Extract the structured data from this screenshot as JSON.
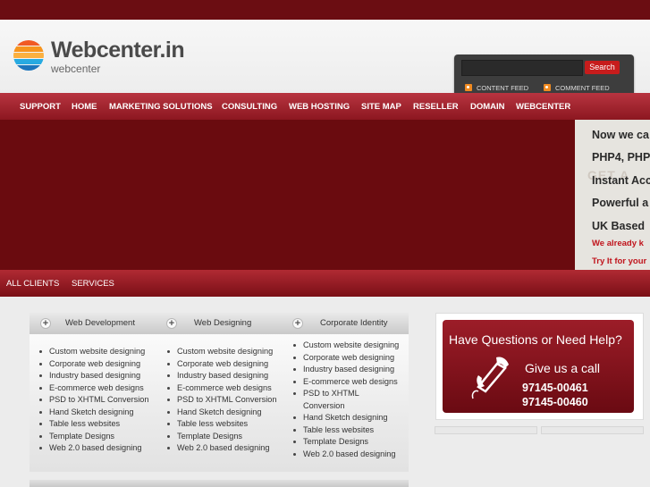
{
  "brand": {
    "title": "Webcenter.in",
    "subtitle": "webcenter"
  },
  "search": {
    "button_label": "Search"
  },
  "feeds": {
    "content": "CONTENT FEED",
    "comment": "COMMENT FEED"
  },
  "nav": [
    "SUPPORT",
    "HOME",
    "MARKETING SOLUTIONS",
    "CONSULTING",
    "WEB HOSTING",
    "SITE MAP",
    "RESELLER",
    "DOMAIN",
    "WEBCENTER"
  ],
  "banner_panel": {
    "lines": [
      "Now we ca",
      "PHP4, PHP",
      "Instant Acc",
      "Powerful a",
      "UK Based"
    ],
    "red_lines": [
      "We already k",
      "Try It for your"
    ],
    "ghost_text": "GET A"
  },
  "subnav": [
    "ALL CLIENTS",
    "SERVICES"
  ],
  "columns": [
    {
      "title": "Web Development",
      "items": [
        "Custom website designing",
        "Corporate web designing",
        "Industry based designing",
        "E-commerce web designs",
        "PSD to XHTML Conversion",
        "Hand Sketch designing",
        "Table less websites",
        "Template Designs",
        "Web 2.0 based designing"
      ]
    },
    {
      "title": "Web Designing",
      "items": [
        "Custom website designing",
        "Corporate web designing",
        "Industry based designing",
        "E-commerce web designs",
        "PSD to XHTML Conversion",
        "Hand Sketch designing",
        "Table less websites",
        "Template Designs",
        "Web 2.0 based designing"
      ]
    },
    {
      "title": "Corporate Identity",
      "items": [
        "Custom website designing",
        "Corporate web designing",
        "Industry based designing",
        "E-commerce web designs",
        "PSD to XHTML",
        "Conversion",
        "Hand Sketch designing",
        "Table less websites",
        "Template Designs",
        "Web 2.0 based designing"
      ]
    }
  ],
  "help": {
    "title": "Have Questions or Need Help?",
    "call": "Give us a call",
    "phones": [
      "97145-00461",
      "97145-00460"
    ]
  },
  "colors": {
    "topbar": "#6b0d12",
    "nav": "#a42430",
    "banner": "#6a0b0f",
    "search_button": "#c71c1c",
    "rss": "#f08a20"
  }
}
